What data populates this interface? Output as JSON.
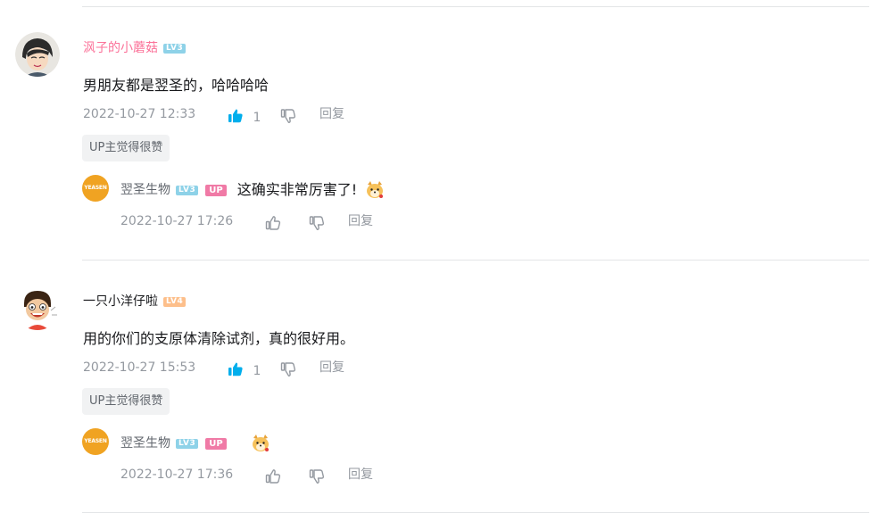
{
  "comments": [
    {
      "username": "沨子的小蘑菇",
      "username_color": "#fb7299",
      "level": "LV3",
      "content": "男朋友都是翌圣的，哈哈哈哈",
      "time": "2022-10-27 12:33",
      "likes": "1",
      "reply_label": "回复",
      "tag": "UP主觉得很赞",
      "reply": {
        "username": "翌圣生物",
        "level": "LV3",
        "up_badge": "UP",
        "text": "这确实非常厉害了!",
        "time": "2022-10-27 17:26",
        "reply_label": "回复",
        "avatar_text": "YEASEN"
      }
    },
    {
      "username": "一只小洋仔啦",
      "username_color": "#18191c",
      "level": "LV4",
      "content": "用的你们的支原体清除试剂，真的很好用。",
      "time": "2022-10-27 15:53",
      "likes": "1",
      "reply_label": "回复",
      "tag": "UP主觉得很赞",
      "reply": {
        "username": "翌圣生物",
        "level": "LV3",
        "up_badge": "UP",
        "text": "",
        "time": "2022-10-27 17:36",
        "reply_label": "回复",
        "avatar_text": "YEASEN"
      }
    }
  ],
  "colors": {
    "like_active": "#00aeec",
    "meta_gray": "#9499a0",
    "level3": "#8ed2e8",
    "level4": "#fdbf8b",
    "up_badge": "#f07aa6",
    "reply_avatar": "#f0a322"
  },
  "icons": {
    "like_filled": "thumbs-up-filled-icon",
    "like_outline": "thumbs-up-outline-icon",
    "dislike": "thumbs-down-icon",
    "emote": "dog-emote-icon"
  }
}
